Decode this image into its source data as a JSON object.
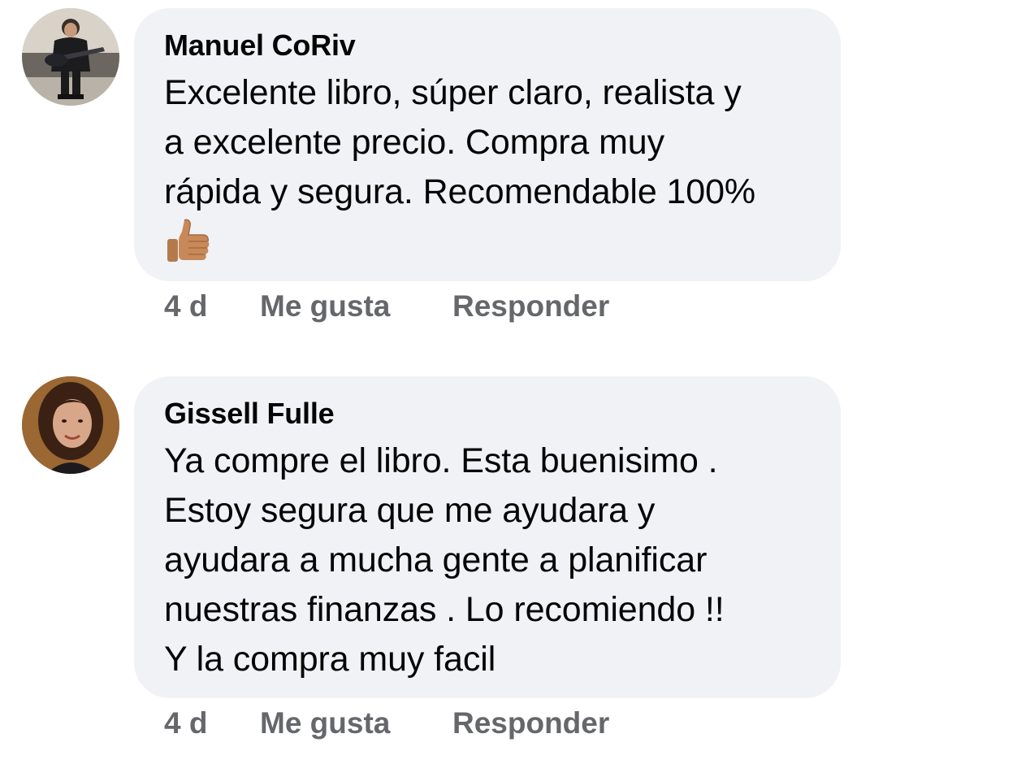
{
  "comments": [
    {
      "author": "Manuel CoRiv",
      "avatar_icon": "person-with-guitar-avatar",
      "text_lines": [
        "Excelente libro, súper claro, realista y",
        "a excelente precio. Compra muy",
        "rápida y segura. Recomendable 100%"
      ],
      "emoji": "👍",
      "emoji_icon": "thumbs-up-icon",
      "time": "4 d",
      "like_label": "Me gusta",
      "reply_label": "Responder"
    },
    {
      "author": "Gissell Fulle",
      "avatar_icon": "woman-portrait-avatar",
      "text_lines": [
        "Ya compre el libro. Esta buenisimo .",
        "Estoy segura que me ayudara y",
        "ayudara a mucha gente a planificar",
        "nuestras finanzas . Lo recomiendo !!",
        "Y la compra muy facil"
      ],
      "time": "4 d",
      "like_label": "Me gusta",
      "reply_label": "Responder"
    }
  ],
  "colors": {
    "bubble_bg": "#f0f2f5",
    "text": "#050505",
    "action_text": "#65676b"
  }
}
